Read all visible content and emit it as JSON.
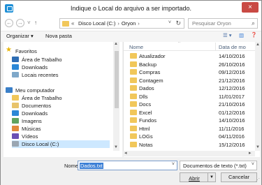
{
  "window": {
    "title": "Indique o Local do arquivo a ser importado.",
    "close_glyph": "×"
  },
  "navbar": {
    "back_glyph": "←",
    "forward_glyph": "→",
    "recent_glyph": "˅",
    "up_glyph": "↑",
    "address_prefix": "«",
    "address_parts": [
      "Disco Local (C:)",
      "Oryon"
    ],
    "address_sep": "›",
    "dropdown_glyph": "˅",
    "refresh_glyph": "↻",
    "search_placeholder": "Pesquisar Oryon",
    "search_glyph": "⌕"
  },
  "toolbar": {
    "organize": "Organizar ▾",
    "new_folder": "Nova pasta",
    "view_glyph": "☰ ▾",
    "pane_glyph": "▥",
    "help_glyph": "❓"
  },
  "nav_pane": {
    "favorites_header": "Favoritos",
    "favorites": [
      {
        "label": "Área de Trabalho",
        "icon": "desktop-icon"
      },
      {
        "label": "Downloads",
        "icon": "downloads-icon"
      },
      {
        "label": "Locais recentes",
        "icon": "recent-places-icon"
      }
    ],
    "computer_header": "Meu computador",
    "computer": [
      {
        "label": "Área de Trabalho",
        "icon": "desktop-icon"
      },
      {
        "label": "Documentos",
        "icon": "documents-icon"
      },
      {
        "label": "Downloads",
        "icon": "downloads-icon"
      },
      {
        "label": "Imagens",
        "icon": "pictures-icon"
      },
      {
        "label": "Músicas",
        "icon": "music-icon"
      },
      {
        "label": "Vídeos",
        "icon": "videos-icon"
      },
      {
        "label": "Disco Local (C:)",
        "icon": "drive-icon"
      }
    ]
  },
  "file_list": {
    "columns": {
      "name": "Nome",
      "date": "Data de mo"
    },
    "rows": [
      {
        "name": "Atualizador",
        "date": "14/10/2016"
      },
      {
        "name": "Backup",
        "date": "26/10/2016"
      },
      {
        "name": "Compras",
        "date": "09/12/2016"
      },
      {
        "name": "Contagem",
        "date": "21/12/2016"
      },
      {
        "name": "Dados",
        "date": "12/12/2016"
      },
      {
        "name": "Dlls",
        "date": "11/01/2017"
      },
      {
        "name": "Docs",
        "date": "21/10/2016"
      },
      {
        "name": "Excel",
        "date": "01/12/2016"
      },
      {
        "name": "Fundos",
        "date": "14/10/2016"
      },
      {
        "name": "Html",
        "date": "11/11/2016"
      },
      {
        "name": "LOGs",
        "date": "04/11/2016"
      },
      {
        "name": "Notas",
        "date": "15/12/2016"
      }
    ]
  },
  "footer": {
    "filename_label": "Nome:",
    "filename_value": "Dados.txt",
    "filetype_value": "Documentos de texto (*.txt)",
    "open_button": "Abrir",
    "cancel_button": "Cancelar"
  },
  "colors": {
    "close_button": "#c94a44",
    "selection": "#cde8ff",
    "folder": "#f1c75a",
    "text_highlight": "#3b7fd6"
  }
}
